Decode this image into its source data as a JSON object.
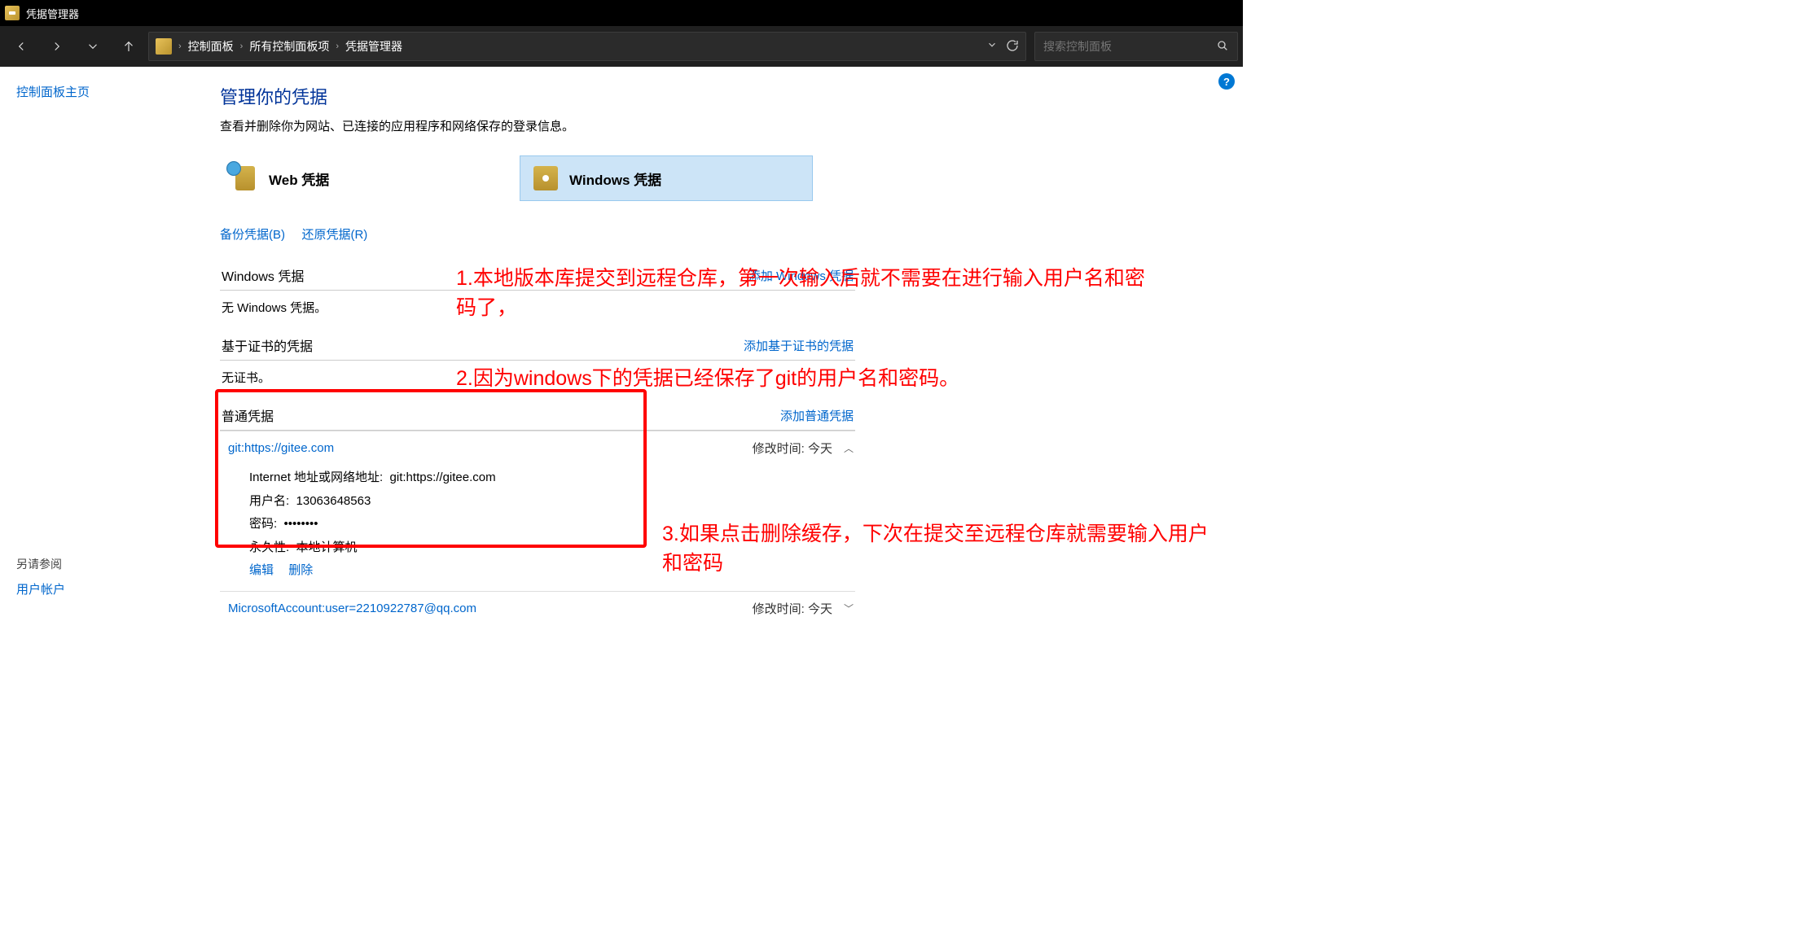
{
  "window": {
    "title": "凭据管理器"
  },
  "breadcrumbs": {
    "a": "控制面板",
    "b": "所有控制面板项",
    "c": "凭据管理器"
  },
  "search": {
    "placeholder": "搜索控制面板"
  },
  "left": {
    "home": "控制面板主页",
    "see_also_header": "另请参阅",
    "see_also_link": "用户帐户"
  },
  "main": {
    "heading": "管理你的凭据",
    "subtext": "查看并删除你为网站、已连接的应用程序和网络保存的登录信息。",
    "tab_web": "Web 凭据",
    "tab_win": "Windows 凭据",
    "backup": "备份凭据(B)",
    "restore": "还原凭据(R)",
    "sections": {
      "win": {
        "title": "Windows 凭据",
        "add": "添加 Windows 凭据",
        "empty": "无 Windows 凭据。"
      },
      "cert": {
        "title": "基于证书的凭据",
        "add": "添加基于证书的凭据",
        "empty": "无证书。"
      },
      "generic": {
        "title": "普通凭据",
        "add": "添加普通凭据"
      }
    },
    "entries": [
      {
        "name": "git:https://gitee.com",
        "modified_label": "修改时间:",
        "modified": "今天",
        "detail": {
          "addr_label": "Internet 地址或网络地址:",
          "addr": "git:https://gitee.com",
          "user_label": "用户名:",
          "user": "13063648563",
          "pwd_label": "密码:",
          "pwd": "••••••••",
          "persist_label": "永久性:",
          "persist": "本地计算机",
          "edit": "编辑",
          "delete": "删除"
        }
      },
      {
        "name": "MicrosoftAccount:user=2210922787@qq.com",
        "modified_label": "修改时间:",
        "modified": "今天"
      }
    ]
  },
  "annotations": {
    "a1": "1.本地版本库提交到远程仓库，第一次输入后就不需要在进行输入用户名和密码了，",
    "a2": "2.因为windows下的凭据已经保存了git的用户名和密码。",
    "a3": "3.如果点击删除缓存，下次在提交至远程仓库就需要输入用户和密码"
  }
}
